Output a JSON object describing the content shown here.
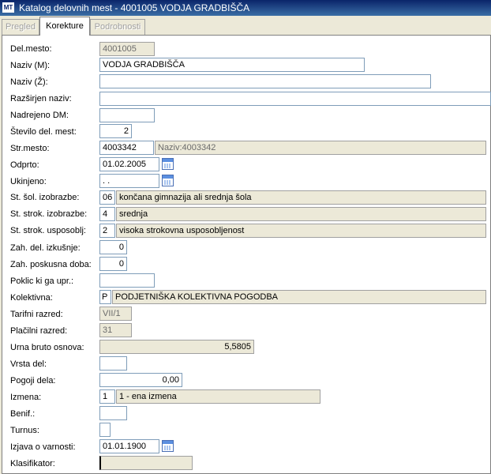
{
  "window": {
    "title": "Katalog delovnih mest - 4001005 VODJA GRADBIŠČA",
    "logo": "MT"
  },
  "tabs": [
    {
      "label": "Pregled"
    },
    {
      "label": "Korekture"
    },
    {
      "label": "Podrobnosti"
    }
  ],
  "form": {
    "del_mesto": {
      "label": "Del.mesto:",
      "value": "4001005"
    },
    "naziv_m": {
      "label": "Naziv (M):",
      "value": "VODJA GRADBIŠČA"
    },
    "naziv_z": {
      "label": "Naziv (Ž):",
      "value": ""
    },
    "razsirjen_naziv": {
      "label": "Razširjen naziv:",
      "value": ""
    },
    "nadrejeno_dm": {
      "label": "Nadrejeno DM:",
      "value": ""
    },
    "stevilo_del_mest": {
      "label": "Število del. mest:",
      "value": "2"
    },
    "str_mesto": {
      "label": "Str.mesto:",
      "value": "4003342",
      "desc": "Naziv:4003342"
    },
    "odprto": {
      "label": "Odprto:",
      "value": "01.02.2005"
    },
    "ukinjeno": {
      "label": "Ukinjeno:",
      "value": ". ."
    },
    "st_sol_izobrazbe": {
      "label": "St. šol. izobrazbe:",
      "value": "06",
      "desc": "končana gimnazija ali srednja šola"
    },
    "st_strok_izobrazbe": {
      "label": "St. strok. izobrazbe:",
      "value": "4",
      "desc": "srednja"
    },
    "st_strok_usposoblj": {
      "label": "St. strok. usposoblj:",
      "value": "2",
      "desc": "visoka strokovna usposobljenost"
    },
    "zah_del_izkusnje": {
      "label": "Zah. del. izkušnje:",
      "value": "0"
    },
    "zah_poskusna_doba": {
      "label": "Zah. poskusna doba:",
      "value": "0"
    },
    "poklic": {
      "label": "Poklic ki ga upr.:",
      "value": ""
    },
    "kolektivna": {
      "label": "Kolektivna:",
      "value": "P",
      "desc": "PODJETNIŠKA KOLEKTIVNA POGODBA"
    },
    "tarifni_razred": {
      "label": "Tarifni razred:",
      "value": "VII/1"
    },
    "placilni_razred": {
      "label": "Plačilni razred:",
      "value": "31"
    },
    "urna_bruto_osnova": {
      "label": "Urna bruto osnova:",
      "value": "5,5805"
    },
    "vrsta_del": {
      "label": "Vrsta del:",
      "value": ""
    },
    "pogoji_dela": {
      "label": "Pogoji dela:",
      "value": "0,00"
    },
    "izmena": {
      "label": "Izmena:",
      "value": "1",
      "desc": "1 - ena izmena"
    },
    "benif": {
      "label": "Benif.:",
      "value": ""
    },
    "turnus": {
      "label": "Turnus:",
      "value": ""
    },
    "izjava_o_varnosti": {
      "label": "Izjava o varnosti:",
      "value": "01.01.1900"
    },
    "klasifikator": {
      "label": "Klasifikator:",
      "value": ""
    }
  }
}
